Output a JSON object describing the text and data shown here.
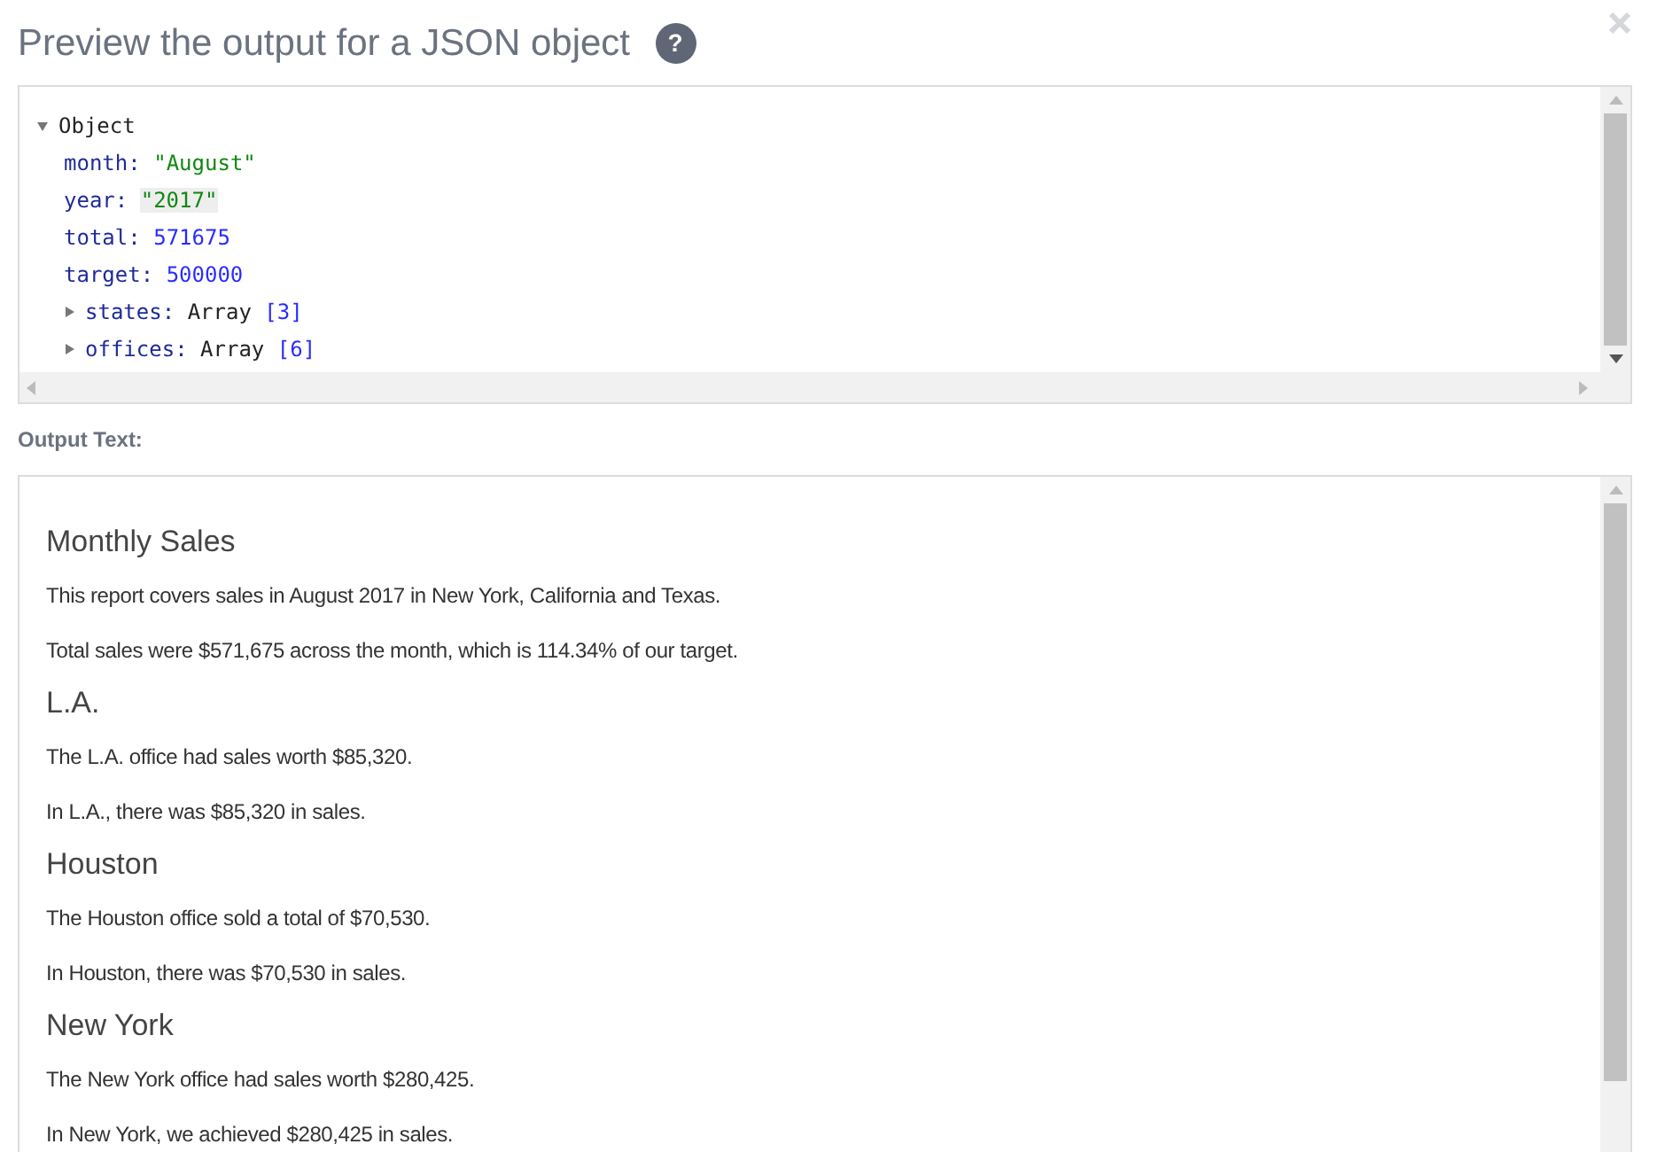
{
  "dialog": {
    "title": "Preview the output for a JSON object",
    "help_icon": "?"
  },
  "json_viewer": {
    "root": {
      "label": "Object",
      "expanded": true
    },
    "entries": [
      {
        "key": "month:",
        "kind": "string",
        "value": "\"August\"",
        "highlighted": false
      },
      {
        "key": "year:",
        "kind": "string",
        "value": "\"2017\"",
        "highlighted": true
      },
      {
        "key": "total:",
        "kind": "number",
        "value": "571675",
        "highlighted": false
      },
      {
        "key": "target:",
        "kind": "number",
        "value": "500000",
        "highlighted": false
      },
      {
        "key": "states:",
        "kind": "array",
        "type_label": "Array",
        "value": "[3]",
        "expanded": false,
        "highlighted": false
      },
      {
        "key": "offices:",
        "kind": "array",
        "type_label": "Array",
        "value": "[6]",
        "expanded": false,
        "highlighted": false
      }
    ]
  },
  "output_label": "Output Text:",
  "output": [
    {
      "kind": "heading",
      "text": "Monthly Sales"
    },
    {
      "kind": "paragraph",
      "text": "This report covers sales in August 2017 in New York, California and Texas."
    },
    {
      "kind": "paragraph",
      "text": "Total sales were $571,675 across the month, which is 114.34% of our target."
    },
    {
      "kind": "heading",
      "text": "L.A."
    },
    {
      "kind": "paragraph",
      "text": "The L.A. office had sales worth $85,320."
    },
    {
      "kind": "paragraph",
      "text": "In L.A., there was $85,320 in sales."
    },
    {
      "kind": "heading",
      "text": "Houston"
    },
    {
      "kind": "paragraph",
      "text": "The Houston office sold a total of $70,530."
    },
    {
      "kind": "paragraph",
      "text": "In Houston, there was $70,530 in sales."
    },
    {
      "kind": "heading",
      "text": "New York"
    },
    {
      "kind": "paragraph",
      "text": "The New York office had sales worth $280,425."
    },
    {
      "kind": "paragraph",
      "text": "In New York, we achieved $280,425 in sales."
    }
  ]
}
